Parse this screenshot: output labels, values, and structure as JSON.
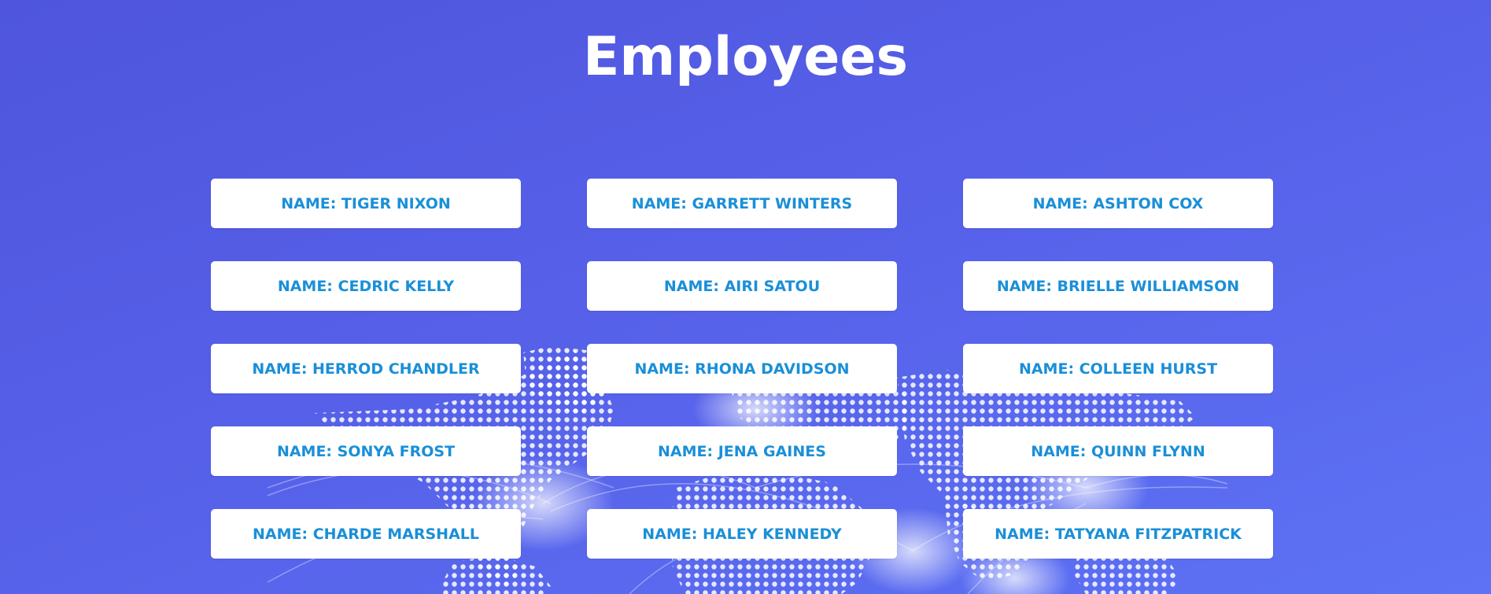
{
  "page": {
    "title": "Employees"
  },
  "employees": [
    {
      "label": "NAME: TIGER NIXON"
    },
    {
      "label": "NAME: GARRETT WINTERS"
    },
    {
      "label": "NAME: ASHTON COX"
    },
    {
      "label": "NAME: CEDRIC KELLY"
    },
    {
      "label": "NAME: AIRI SATOU"
    },
    {
      "label": "NAME: BRIELLE WILLIAMSON"
    },
    {
      "label": "NAME: HERROD CHANDLER"
    },
    {
      "label": "NAME: RHONA DAVIDSON"
    },
    {
      "label": "NAME: COLLEEN HURST"
    },
    {
      "label": "NAME: SONYA FROST"
    },
    {
      "label": "NAME: JENA GAINES"
    },
    {
      "label": "NAME: QUINN FLYNN"
    },
    {
      "label": "NAME: CHARDE MARSHALL"
    },
    {
      "label": "NAME: HALEY KENNEDY"
    },
    {
      "label": "NAME: TATYANA FITZPATRICK"
    }
  ],
  "colors": {
    "background_start": "#4f55dd",
    "background_end": "#5d72f5",
    "card_background": "#ffffff",
    "card_text": "#1a8fd8",
    "title_text": "#ffffff"
  },
  "background": {
    "graphic": "dotted-world-map"
  }
}
